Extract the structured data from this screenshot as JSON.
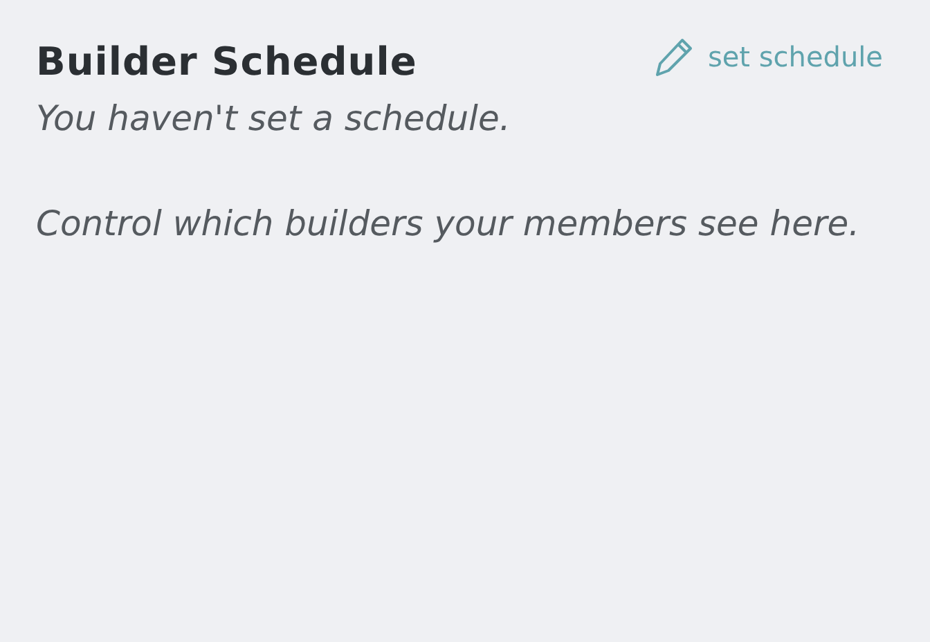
{
  "title": "Builder Schedule",
  "action": {
    "label": "set schedule"
  },
  "paragraphs": [
    "You haven't set a schedule.",
    "Control which builders your members see here."
  ]
}
